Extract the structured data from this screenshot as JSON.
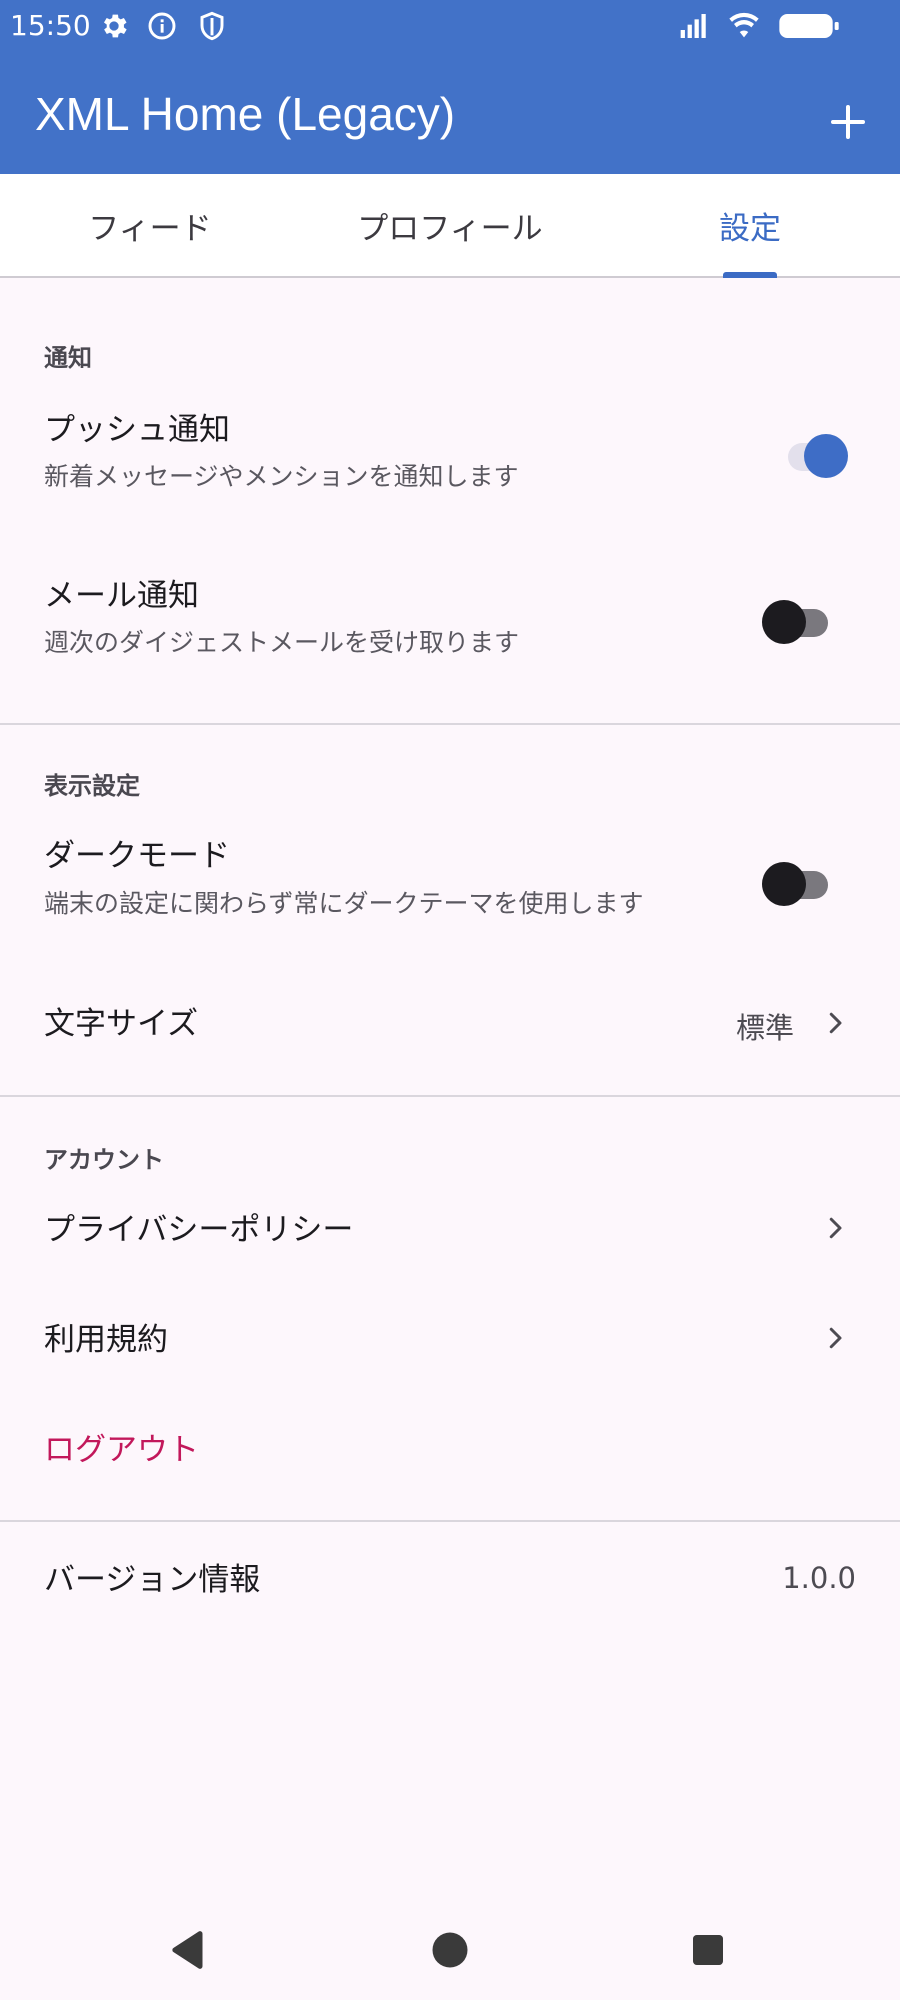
{
  "status_bar": {
    "time": "15:50",
    "icons": [
      "gear-icon",
      "info-icon",
      "shield-icon",
      "signal-icon",
      "wifi-icon",
      "battery-icon"
    ]
  },
  "app_bar": {
    "title": "XML Home (Legacy)",
    "action_icon": "plus-icon",
    "color": "#4272C8"
  },
  "tabs": [
    {
      "label": "フィード",
      "active": false
    },
    {
      "label": "プロフィール",
      "active": false
    },
    {
      "label": "設定",
      "active": true
    }
  ],
  "accent_color": "#3B6BC4",
  "sections": {
    "notifications": {
      "header": "通知",
      "push": {
        "title": "プッシュ通知",
        "subtitle": "新着メッセージやメンションを通知します",
        "enabled": true
      },
      "email": {
        "title": "メール通知",
        "subtitle": "週次のダイジェストメールを受け取ります",
        "enabled": false
      }
    },
    "display": {
      "header": "表示設定",
      "dark_mode": {
        "title": "ダークモード",
        "subtitle": "端末の設定に関わらず常にダークテーマを使用します",
        "enabled": false
      },
      "font_size": {
        "title": "文字サイズ",
        "value": "標準"
      }
    },
    "account": {
      "header": "アカウント",
      "privacy": {
        "title": "プライバシーポリシー"
      },
      "terms": {
        "title": "利用規約"
      },
      "logout": {
        "title": "ログアウト",
        "color": "#C2185B"
      }
    },
    "version": {
      "title": "バージョン情報",
      "value": "1.0.0"
    }
  },
  "nav_bar": {
    "icons": [
      "back-icon",
      "home-icon",
      "recents-icon"
    ]
  }
}
